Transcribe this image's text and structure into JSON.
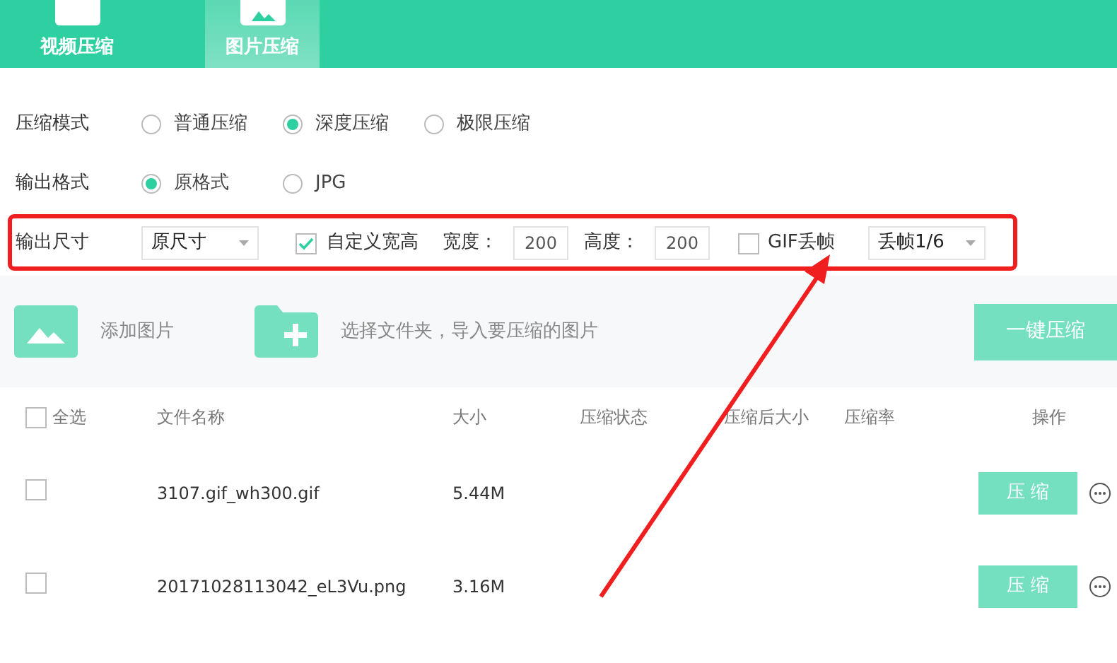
{
  "tabs": [
    {
      "label": "视频压缩",
      "selected": false,
      "kind": "video"
    },
    {
      "label": "图片压缩",
      "selected": true,
      "kind": "image"
    }
  ],
  "compress_mode": {
    "label": "压缩模式",
    "options": [
      {
        "label": "普通压缩",
        "selected": false
      },
      {
        "label": "深度压缩",
        "selected": true
      },
      {
        "label": "极限压缩",
        "selected": false
      }
    ]
  },
  "output_format": {
    "label": "输出格式",
    "options": [
      {
        "label": "原格式",
        "selected": true
      },
      {
        "label": "JPG",
        "selected": false
      }
    ]
  },
  "output_size": {
    "label": "输出尺寸",
    "size_select": {
      "value": "原尺寸"
    },
    "custom_size": {
      "label": "自定义宽高",
      "checked": true
    },
    "width": {
      "label": "宽度：",
      "value": "200"
    },
    "height": {
      "label": "高度：",
      "value": "200"
    },
    "gif_drop": {
      "label": "GIF丢帧",
      "checked": false
    },
    "drop_select": {
      "value": "丢帧1/6"
    }
  },
  "toolbar": {
    "add_image": "添加图片",
    "add_folder": "选择文件夹，导入要压缩的图片",
    "compress_all": "一键压缩"
  },
  "table": {
    "select_all": {
      "label": "全选",
      "checked": false
    },
    "columns": [
      "文件名称",
      "大小",
      "压缩状态",
      "压缩后大小",
      "压缩率",
      "操作"
    ],
    "rows": [
      {
        "name": "3107.gif_wh300.gif",
        "size": "5.44M",
        "checked": false,
        "action": "压 缩"
      },
      {
        "name": "20171028113042_eL3Vu.png",
        "size": "3.16M",
        "checked": false,
        "action": "压 缩"
      }
    ]
  }
}
